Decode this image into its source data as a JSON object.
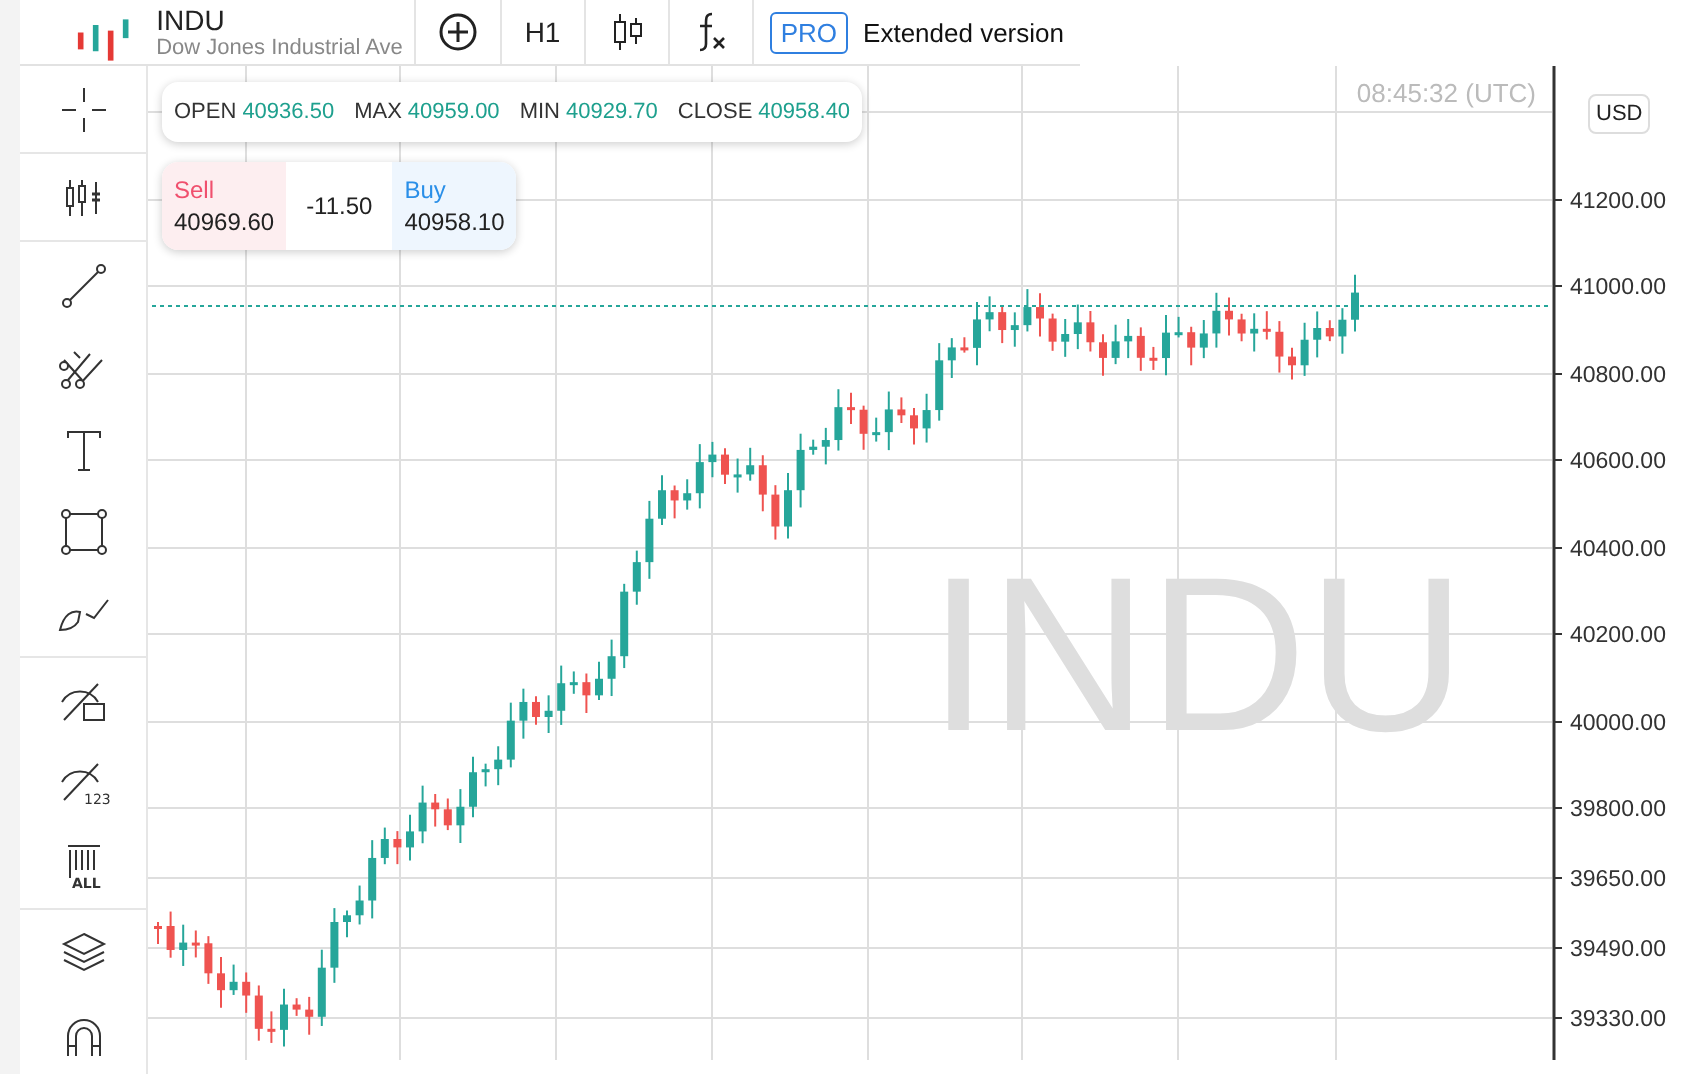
{
  "header": {
    "symbol": "INDU",
    "description": "Dow Jones Industrial Ave",
    "tools": [
      {
        "kind": "add"
      },
      {
        "kind": "label",
        "label": "H1"
      },
      {
        "kind": "candles"
      },
      {
        "kind": "fx"
      }
    ],
    "pro_badge": "PRO",
    "extended_label": "Extended version"
  },
  "toolbar": {
    "groups": [
      [
        {
          "kind": "crosshair"
        }
      ],
      [
        {
          "kind": "indicators"
        }
      ],
      [
        {
          "kind": "line"
        },
        {
          "kind": "fork"
        },
        {
          "kind": "text"
        },
        {
          "kind": "rectangle"
        },
        {
          "kind": "brush"
        }
      ],
      [
        {
          "kind": "hide-drawings"
        },
        {
          "kind": "hide-numbers",
          "mark": "123"
        },
        {
          "kind": "delete-all",
          "mark": "ALL"
        }
      ],
      [
        {
          "kind": "layers"
        },
        {
          "kind": "magnet"
        }
      ]
    ]
  },
  "chart": {
    "time": "08:45:32 (UTC)",
    "watermark": "INDU",
    "currency": "USD",
    "ohlc": [
      {
        "label": "OPEN",
        "value": "40936.50"
      },
      {
        "label": "MAX",
        "value": "40959.00"
      },
      {
        "label": "MIN",
        "value": "40929.70"
      },
      {
        "label": "CLOSE",
        "value": "40958.40"
      }
    ],
    "sell": {
      "label": "Sell",
      "price": "40969.60"
    },
    "spread": "-11.50",
    "buy": {
      "label": "Buy",
      "price": "40958.10"
    },
    "y_axis": [
      "41200.00",
      "41000.00",
      "40800.00",
      "40600.00",
      "40400.00",
      "40200.00",
      "40000.00",
      "39800.00",
      "39650.00",
      "39490.00",
      "39330.00"
    ]
  }
}
